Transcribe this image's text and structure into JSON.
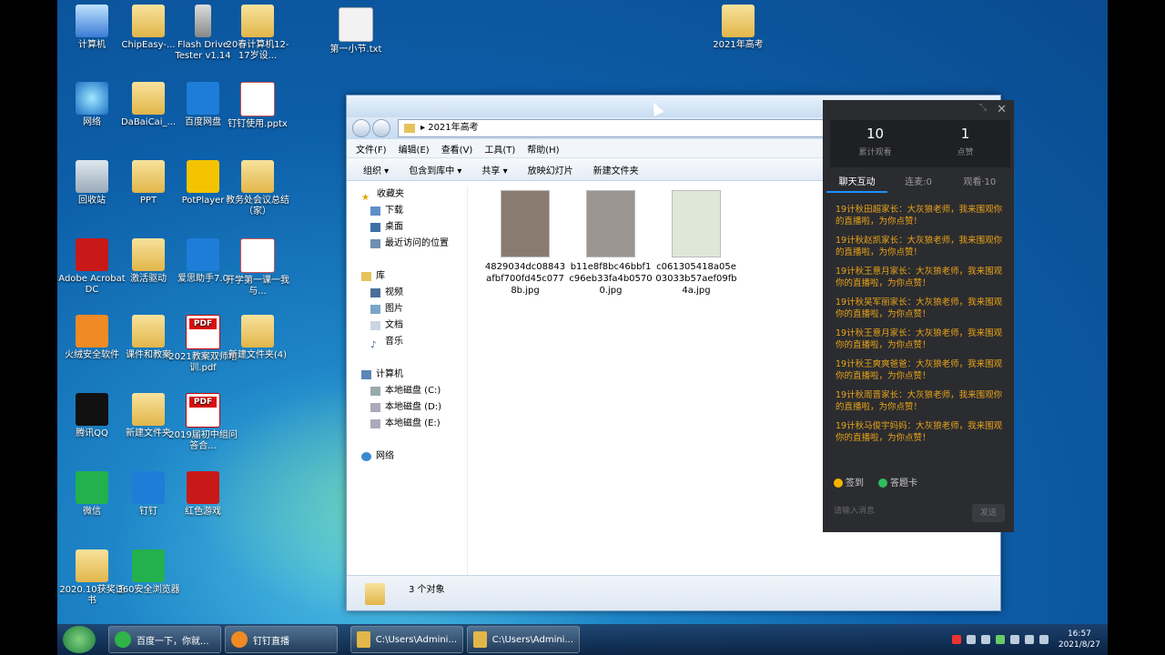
{
  "desktop_icons": [
    {
      "label": "计算机",
      "kind": "app-comp",
      "icon": "computer-icon"
    },
    {
      "label": "ChipEasy-...",
      "kind": "folder",
      "icon": "folder-icon"
    },
    {
      "label": "Flash Drive Tester v1.14",
      "kind": "app-usb",
      "icon": "usb-icon"
    },
    {
      "label": "20春计算机12-17岁设...",
      "kind": "folder",
      "icon": "folder-icon"
    },
    {
      "label": "第一小节.txt",
      "kind": "doc",
      "icon": "text-file-icon"
    },
    {
      "label": "2021年高考",
      "kind": "folder",
      "icon": "folder-icon"
    },
    {
      "label": "网络",
      "kind": "app-net",
      "icon": "network-icon"
    },
    {
      "label": "DaBaiCai_...",
      "kind": "folder",
      "icon": "folder-icon"
    },
    {
      "label": "百度网盘",
      "kind": "app-blue",
      "icon": "baidu-netdisk-icon"
    },
    {
      "label": "钉钉使用.pptx",
      "kind": "app-ppt",
      "icon": "pptx-icon"
    },
    {
      "label": "回收站",
      "kind": "app-trash",
      "icon": "recycle-bin-icon"
    },
    {
      "label": "PPT",
      "kind": "folder",
      "icon": "folder-icon"
    },
    {
      "label": "PotPlayer",
      "kind": "app-yellow",
      "icon": "potplayer-icon"
    },
    {
      "label": "教务处会议总结（家）",
      "kind": "folder",
      "icon": "folder-icon"
    },
    {
      "label": "Adobe Acrobat DC",
      "kind": "app-red",
      "icon": "acrobat-icon"
    },
    {
      "label": "激活驱动",
      "kind": "folder",
      "icon": "folder-icon"
    },
    {
      "label": "爱思助手7.0",
      "kind": "app-blue",
      "icon": "aisi-icon"
    },
    {
      "label": "开学第一课一我与...",
      "kind": "app-ppt",
      "icon": "pptx-icon"
    },
    {
      "label": "火绒安全软件",
      "kind": "app-orange",
      "icon": "huorong-icon"
    },
    {
      "label": "课件和教案",
      "kind": "folder",
      "icon": "folder-icon"
    },
    {
      "label": "2021教案双师培训.pdf",
      "kind": "pdf",
      "icon": "pdf-icon"
    },
    {
      "label": "新建文件夹(4)",
      "kind": "folder",
      "icon": "folder-icon"
    },
    {
      "label": "腾讯QQ",
      "kind": "app-qq",
      "icon": "qq-icon"
    },
    {
      "label": "新建文件夹",
      "kind": "folder",
      "icon": "folder-icon"
    },
    {
      "label": "2019届初中组问答合...",
      "kind": "pdf",
      "icon": "pdf-icon"
    },
    {
      "label": "微信",
      "kind": "app-green",
      "icon": "wechat-icon"
    },
    {
      "label": "钉钉",
      "kind": "app-blue",
      "icon": "dingtalk-icon"
    },
    {
      "label": "红色游戏",
      "kind": "app-red",
      "icon": "game-icon"
    },
    {
      "label": "2020.10获奖证书",
      "kind": "folder",
      "icon": "folder-icon"
    },
    {
      "label": "360安全浏览器",
      "kind": "app-green",
      "icon": "360-browser-icon"
    }
  ],
  "explorer": {
    "path": "2021年高考",
    "menu": [
      "文件(F)",
      "编辑(E)",
      "查看(V)",
      "工具(T)",
      "帮助(H)"
    ],
    "toolbar": [
      "组织 ▾",
      "包含到库中 ▾",
      "共享 ▾",
      "放映幻灯片",
      "新建文件夹"
    ],
    "nav": {
      "favorites": "收藏夹",
      "downloads": "下载",
      "desktop": "桌面",
      "recent": "最近访问的位置",
      "libraries": "库",
      "videos": "视频",
      "pictures": "图片",
      "documents": "文档",
      "music": "音乐",
      "computer": "计算机",
      "drive_c": "本地磁盘 (C:)",
      "drive_d": "本地磁盘 (D:)",
      "drive_e": "本地磁盘 (E:)",
      "network": "网络"
    },
    "files": [
      {
        "name": "4829034dc08843afbf700fd45c0778b.jpg",
        "color": "#8a7b70"
      },
      {
        "name": "b11e8f8bc46bbf1c96eb33fa4b05700.jpg",
        "color": "#9a9590"
      },
      {
        "name": "c061305418a05e03033b57aef09fb4a.jpg",
        "color": "#dfe8d8"
      }
    ],
    "status": "3 个对象"
  },
  "live_panel": {
    "views": "10",
    "views_label": "累计观看",
    "likes": "1",
    "likes_label": "点赞",
    "tabs": [
      "聊天互动",
      "连麦:0",
      "观看·10"
    ],
    "messages": [
      "19计秋田超家长：大灰狼老师，我来围观你的直播啦，为你点赞！",
      "19计秋赵凯家长：大灰狼老师，我来围观你的直播啦，为你点赞！",
      "19计秋王意月家长：大灰狼老师，我来围观你的直播啦，为你点赞！",
      "19计秋吴军丽家长：大灰狼老师，我来围观你的直播啦，为你点赞！",
      "19计秋王意月家长：大灰狼老师，我来围观你的直播啦，为你点赞！",
      "19计秋王爽爽爸爸：大灰狼老师，我来围观你的直播啦，为你点赞！",
      "19计秋周晋家长：大灰狼老师，我来围观你的直播啦，为你点赞！",
      "19计秋马俊宇妈妈：大灰狼老师，我来围观你的直播啦，为你点赞！"
    ],
    "action_signin": "签到",
    "action_answer": "答题卡",
    "input_placeholder": "请输入消息",
    "send": "发送"
  },
  "taskbar": {
    "items": [
      "百度一下，你就...",
      "钉钉直播",
      "C:\\Users\\Admini...",
      "C:\\Users\\Admini..."
    ],
    "time": "16:57",
    "date": "2021/8/27"
  }
}
